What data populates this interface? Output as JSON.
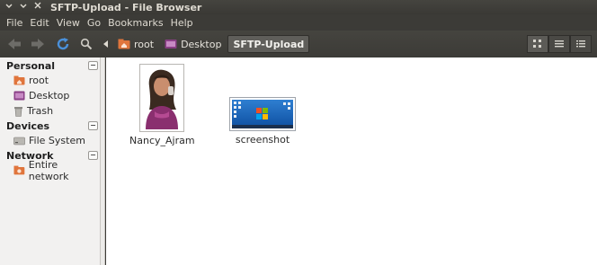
{
  "window": {
    "title": "SFTP-Upload - File Browser"
  },
  "menu": {
    "items": [
      "File",
      "Edit",
      "View",
      "Go",
      "Bookmarks",
      "Help"
    ]
  },
  "breadcrumb": {
    "items": [
      "root",
      "Desktop",
      "SFTP-Upload"
    ],
    "active_index": 2
  },
  "sidebar": {
    "sections": [
      {
        "title": "Personal",
        "items": [
          "root",
          "Desktop",
          "Trash"
        ]
      },
      {
        "title": "Devices",
        "items": [
          "File System"
        ]
      },
      {
        "title": "Network",
        "items": [
          "Entire network"
        ]
      }
    ]
  },
  "files": [
    {
      "name": "Nancy_Ajram",
      "type": "image"
    },
    {
      "name": "screenshot",
      "type": "image"
    }
  ],
  "colors": {
    "titlebar": "#3c3b37",
    "accent": "#e05a2b",
    "refresh": "#4a90d9"
  }
}
